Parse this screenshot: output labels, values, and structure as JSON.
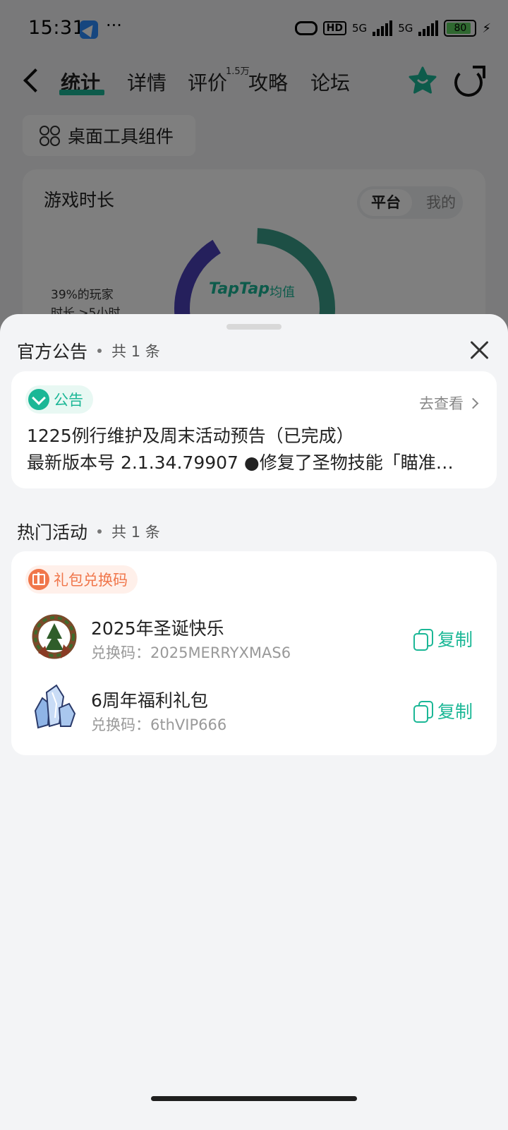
{
  "status": {
    "time": "15:31",
    "dots": "···",
    "hd": "HD",
    "net1": "5G",
    "net2": "5G",
    "battery": "80"
  },
  "nav": {
    "tabs": [
      "统计",
      "详情",
      "评价",
      "攻略",
      "论坛"
    ],
    "active_tab": "统计",
    "review_badge": "1.5万"
  },
  "background": {
    "widget_label": "桌面工具组件",
    "stats_title": "游戏时长",
    "seg_platform": "平台",
    "seg_mine": "我的",
    "stat_line1": "39%的玩家",
    "stat_line2": "时长 >5小时",
    "brand": "TapTap",
    "brand_sub": "均值"
  },
  "announcements": {
    "title": "官方公告",
    "count": "共 1 条",
    "tag": "公告",
    "goto": "去查看",
    "item_title": "1225例行维护及周末活动预告（已完成）",
    "item_preview": "最新版本号 2.1.34.79907 ●修复了圣物技能「瞄准…"
  },
  "activities": {
    "title": "热门活动",
    "count": "共 1 条",
    "tag": "礼包兑换码",
    "items": [
      {
        "name": "2025年圣诞快乐",
        "code": "兑换码：2025MERRYXMAS6",
        "copy": "复制",
        "thumb": "wreath-icon"
      },
      {
        "name": "6周年福利礼包",
        "code": "兑换码：6thVIP666",
        "copy": "复制",
        "thumb": "crystal-icon"
      }
    ]
  },
  "colors": {
    "accent": "#1bb796",
    "orange": "#f0764a",
    "sheet_bg": "#f3f4f6"
  }
}
